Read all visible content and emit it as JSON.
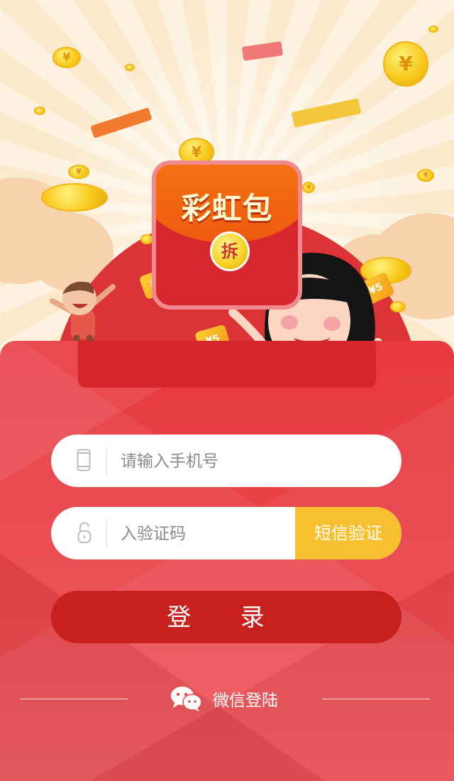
{
  "envelope": {
    "title": "彩虹包",
    "open_label": "拆"
  },
  "decor": {
    "coin_symbol": "¥",
    "ticket_label": "¥5"
  },
  "form": {
    "phone_placeholder": "请输入手机号",
    "code_placeholder": "入验证码",
    "sms_button": "短信验证",
    "login_button": "登 录"
  },
  "wechat": {
    "label": "微信登陆"
  },
  "colors": {
    "panel_red": "#e73a40",
    "login_red": "#c8211d",
    "sms_yellow": "#f8c02f"
  }
}
